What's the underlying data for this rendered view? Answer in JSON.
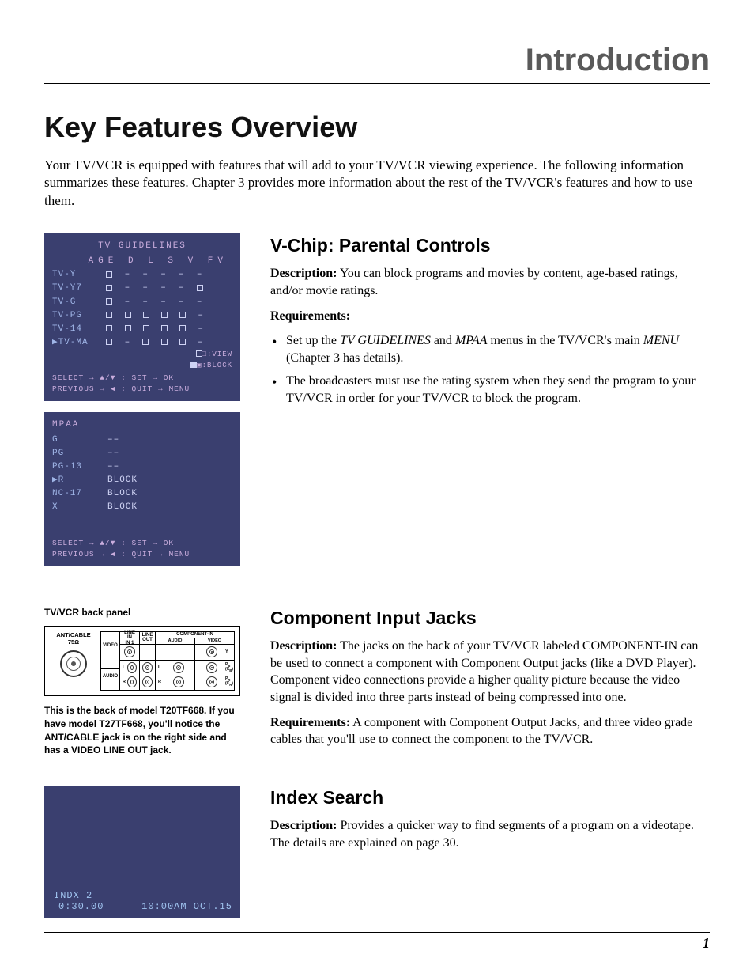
{
  "header": {
    "section": "Introduction"
  },
  "page": {
    "title": "Key Features Overview",
    "intro": "Your TV/VCR is equipped with features that will add to your TV/VCR viewing experience. The following information summarizes these features. Chapter 3 provides more information about the rest of the TV/VCR's features and how to use them.",
    "number": "1"
  },
  "vchip": {
    "heading": "V-Chip: Parental Controls",
    "desc_label": "Description:",
    "desc": " You can block programs and movies by content, age-based ratings, and/or movie ratings.",
    "req_label": "Requirements:",
    "bullets": {
      "b1_pre": "Set up the ",
      "b1_i1": "TV GUIDELINES",
      "b1_mid": " and ",
      "b1_i2": "MPAA",
      "b1_mid2": " menus in the TV/VCR's main ",
      "b1_i3": "MENU",
      "b1_post": " (Chapter 3 has details).",
      "b2": "The broadcasters must use the rating system when they send the program to your TV/VCR in order for your TV/VCR to block the program."
    }
  },
  "component": {
    "heading": "Component Input Jacks",
    "desc_label": "Description:",
    "desc": " The jacks on the back of your TV/VCR labeled COMPONENT-IN can be used to connect a component with Component Output jacks (like a DVD Player). Component video connections provide a higher quality picture because the video signal is divided into three parts instead of being compressed into one.",
    "req_label": "Requirements:",
    "req": " A component with Component Output Jacks, and three video grade cables that you'll use to connect the component to the TV/VCR."
  },
  "index": {
    "heading": "Index Search",
    "desc_label": "Description:",
    "desc": " Provides a quicker way to find segments of a program on a videotape. The details are explained on page 30."
  },
  "osd_tv": {
    "title": "TV GUIDELINES",
    "headers": "AGE D L S V FV",
    "rows": [
      {
        "label": "TV-Y",
        "age": "□",
        "d": "–",
        "l": "–",
        "s": "–",
        "v": "–",
        "fv": "–"
      },
      {
        "label": "TV-Y7",
        "age": "□",
        "d": "–",
        "l": "–",
        "s": "–",
        "v": "–",
        "fv": "□"
      },
      {
        "label": "TV-G",
        "age": "□",
        "d": "–",
        "l": "–",
        "s": "–",
        "v": "–",
        "fv": "–"
      },
      {
        "label": "TV-PG",
        "age": "□",
        "d": "□",
        "l": "□",
        "s": "□",
        "v": "□",
        "fv": "–"
      },
      {
        "label": "TV-14",
        "age": "□",
        "d": "□",
        "l": "□",
        "s": "□",
        "v": "□",
        "fv": "–"
      },
      {
        "label": "▶TV-MA",
        "age": "□",
        "d": "–",
        "l": "□",
        "s": "□",
        "v": "□",
        "fv": "–"
      }
    ],
    "legend_view": "□:VIEW",
    "legend_block": "▣:BLOCK",
    "foot1": "SELECT   → ▲/▼  : SET  → OK",
    "foot2": "PREVIOUS → ◀    : QUIT → MENU"
  },
  "osd_mpaa": {
    "title": "MPAA",
    "rows": [
      {
        "label": "G",
        "val": "––"
      },
      {
        "label": "PG",
        "val": "––"
      },
      {
        "label": "PG-13",
        "val": "––"
      },
      {
        "label": "▶R",
        "val": "BLOCK"
      },
      {
        "label": "NC-17",
        "val": "BLOCK"
      },
      {
        "label": "X",
        "val": "BLOCK"
      }
    ],
    "foot1": "SELECT   → ▲/▼  : SET  → OK",
    "foot2": "PREVIOUS → ◀    : QUIT → MENU"
  },
  "backpanel": {
    "caption_title": "TV/VCR back panel",
    "ant_label": "ANT/CABLE",
    "ant_ohm": "75Ω",
    "row_video": "VIDEO",
    "row_audio": "AUDIO",
    "l": "L",
    "r": "R",
    "col_linein": "LINE IN\nIN 1",
    "col_lineout": "LINE\nOUT",
    "col_comp": "COMPONENT-IN",
    "col_audio": "AUDIO",
    "col_video": "VIDEO",
    "y": "Y",
    "pb": "PB\n(CB)",
    "pr": "PR\n(CR)",
    "caption_note": "This is the back of model T20TF668. If you have model T27TF668, you'll notice the ANT/CABLE jack is on the right side and has a VIDEO LINE OUT jack."
  },
  "indx_osd": {
    "l1": "INDX 2",
    "l2": "0:30.00",
    "l3": "10:00AM OCT.15"
  }
}
